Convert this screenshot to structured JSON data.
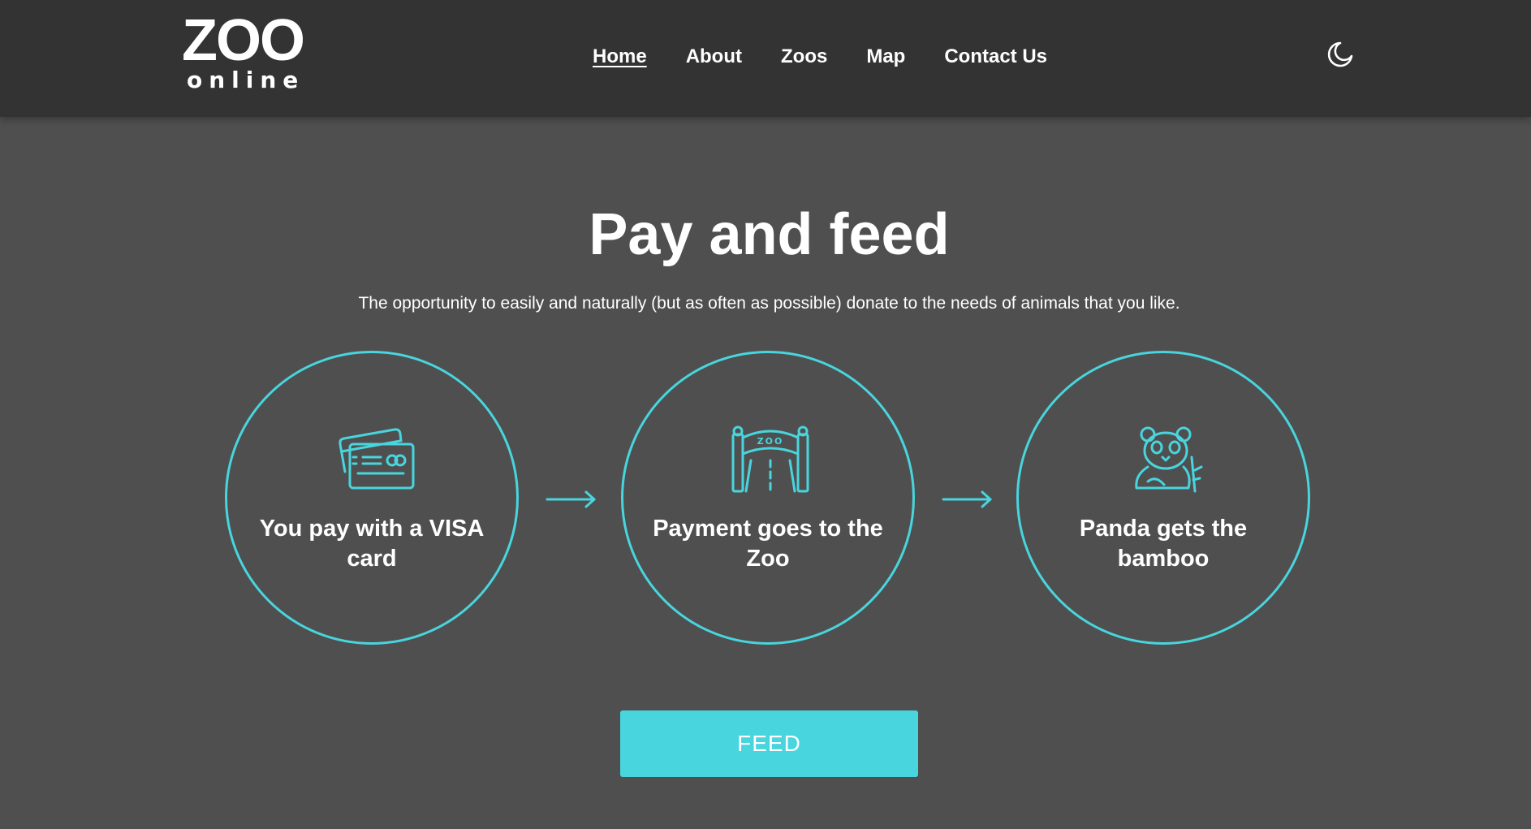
{
  "colors": {
    "header_bg": "#333333",
    "page_bg": "#4f4f4f",
    "accent": "#48d5dd",
    "text": "#ffffff"
  },
  "header": {
    "logo": {
      "main": "ZOO",
      "sub": "online"
    },
    "nav": [
      {
        "label": "Home",
        "active": true
      },
      {
        "label": "About",
        "active": false
      },
      {
        "label": "Zoos",
        "active": false
      },
      {
        "label": "Map",
        "active": false
      },
      {
        "label": "Contact Us",
        "active": false
      }
    ],
    "theme_toggle_icon": "moon-icon"
  },
  "hero": {
    "title": "Pay and feed",
    "subtitle": "The opportunity to easily and naturally (but as often as possible) donate to the needs of animals that you like."
  },
  "steps": [
    {
      "icon": "credit-cards-icon",
      "label": "You pay with a VISA card"
    },
    {
      "icon": "zoo-gate-icon",
      "label": "Payment goes to the Zoo"
    },
    {
      "icon": "panda-icon",
      "label": "Panda gets the bamboo"
    }
  ],
  "step_separator_icon": "arrow-right-icon",
  "cta": {
    "label": "FEED"
  }
}
